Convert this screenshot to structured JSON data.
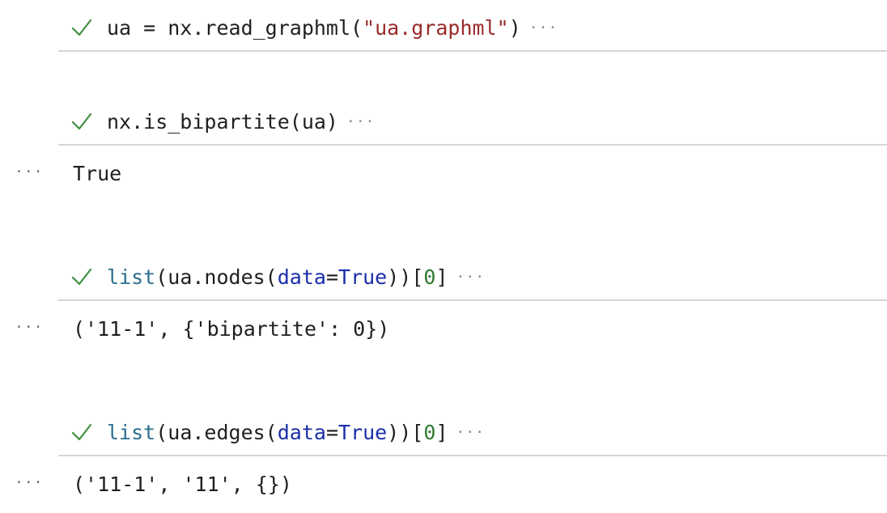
{
  "cells": [
    {
      "id": "cell-1",
      "tokens": [
        {
          "text": "ua = nx.read_graphml(",
          "kind": "plain"
        },
        {
          "text": "\"ua.graphml\"",
          "kind": "str"
        },
        {
          "text": ")",
          "kind": "plain"
        }
      ],
      "more": "···",
      "output": null
    },
    {
      "id": "cell-2",
      "tokens": [
        {
          "text": "nx.is_bipartite(ua)",
          "kind": "plain"
        }
      ],
      "more": "···",
      "output_dots": "···",
      "output": "True"
    },
    {
      "id": "cell-3",
      "tokens": [
        {
          "text": "list",
          "kind": "builtin"
        },
        {
          "text": "(ua.nodes(",
          "kind": "plain"
        },
        {
          "text": "data",
          "kind": "kw"
        },
        {
          "text": "=",
          "kind": "plain"
        },
        {
          "text": "True",
          "kind": "const"
        },
        {
          "text": "))[",
          "kind": "plain"
        },
        {
          "text": "0",
          "kind": "num"
        },
        {
          "text": "]",
          "kind": "plain"
        }
      ],
      "more": "···",
      "output_dots": "···",
      "output": "('11-1', {'bipartite': 0})"
    },
    {
      "id": "cell-4",
      "tokens": [
        {
          "text": "list",
          "kind": "builtin"
        },
        {
          "text": "(ua.edges(",
          "kind": "plain"
        },
        {
          "text": "data",
          "kind": "kw"
        },
        {
          "text": "=",
          "kind": "plain"
        },
        {
          "text": "True",
          "kind": "const"
        },
        {
          "text": "))[",
          "kind": "plain"
        },
        {
          "text": "0",
          "kind": "num"
        },
        {
          "text": "]",
          "kind": "plain"
        }
      ],
      "more": "···",
      "output_dots": "···",
      "output": "('11-1', '11', {})"
    }
  ],
  "colors": {
    "check": "#3f8f3f",
    "string": "#9a2a2a",
    "builtin": "#2a6f8f",
    "keyword": "#1a2fa8",
    "number": "#2f7a2f",
    "separator": "#d6d6d6"
  },
  "icons": {
    "status": "checkmark-icon",
    "more": "more-horizontal-icon"
  }
}
